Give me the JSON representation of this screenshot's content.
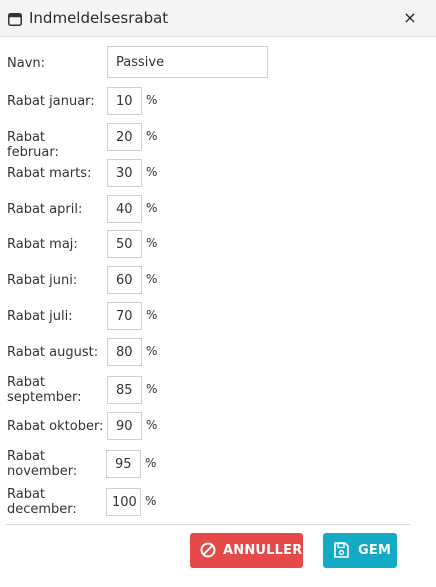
{
  "dialog": {
    "title": "Indmeldelsesrabat",
    "close_label": "×"
  },
  "form": {
    "name_label": "Navn:",
    "name_value": "Passive",
    "percent_suffix": "%",
    "rows": [
      {
        "label": "Rabat januar:",
        "value": "10"
      },
      {
        "label": "Rabat februar:",
        "value": "20"
      },
      {
        "label": "Rabat marts:",
        "value": "30"
      },
      {
        "label": "Rabat april:",
        "value": "40"
      },
      {
        "label": "Rabat maj:",
        "value": "50"
      },
      {
        "label": "Rabat juni:",
        "value": "60"
      },
      {
        "label": "Rabat juli:",
        "value": "70"
      },
      {
        "label": "Rabat august:",
        "value": "80"
      },
      {
        "label": "Rabat september:",
        "value": "85"
      },
      {
        "label": "Rabat oktober:",
        "value": "90"
      },
      {
        "label": "Rabat november:",
        "value": "95"
      },
      {
        "label": "Rabat december:",
        "value": "100"
      }
    ]
  },
  "buttons": {
    "cancel_label": "ANNULLER",
    "cancel_icon": "ban-icon",
    "cancel_color": "#e5494a",
    "save_label": "GEM",
    "save_icon": "floppy-disk-icon",
    "save_color": "#14a9c5"
  }
}
